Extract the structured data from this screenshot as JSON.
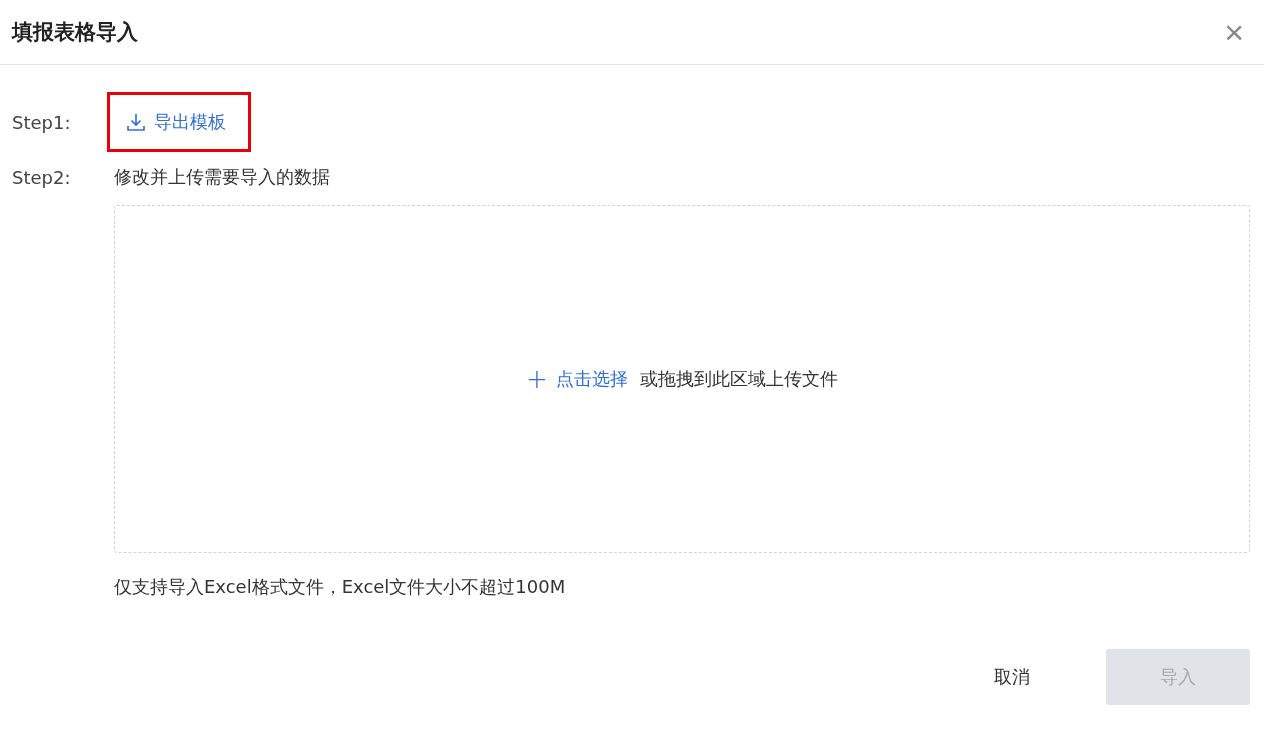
{
  "dialog": {
    "title": "填报表格导入",
    "close_icon": "×"
  },
  "steps": [
    {
      "label": "Step1:",
      "kind": "link",
      "text": "导出模板",
      "highlighted": true
    },
    {
      "label": "Step2:",
      "kind": "text",
      "text": "修改并上传需要导入的数据"
    }
  ],
  "upload": {
    "plus": "+",
    "link": "点击选择",
    "text": "或拖拽到此区域上传文件"
  },
  "note": "仅支持导入Excel格式文件，Excel文件大小不超过100M",
  "buttons": [
    {
      "label": "取消",
      "kind": "text",
      "disabled": false
    },
    {
      "label": "导入",
      "kind": "primary",
      "disabled": true
    }
  ]
}
